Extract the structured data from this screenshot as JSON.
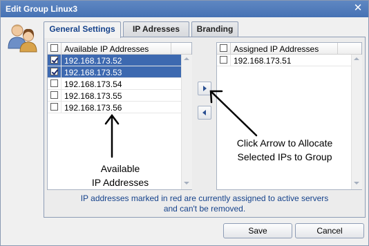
{
  "window": {
    "title": "Edit Group Linux3"
  },
  "icons": {
    "close": "close-icon",
    "group": "user-group-icon"
  },
  "tabs": [
    {
      "label": "General Settings",
      "active": true
    },
    {
      "label": "IP Adresses",
      "active": false
    },
    {
      "label": "Branding",
      "active": false
    }
  ],
  "available": {
    "header": "Available IP Addresses",
    "rows": [
      {
        "ip": "192.168.173.52",
        "checked": true,
        "selected": true
      },
      {
        "ip": "192.168.173.53",
        "checked": true,
        "selected": true
      },
      {
        "ip": "192.168.173.54",
        "checked": false,
        "selected": false
      },
      {
        "ip": "192.168.173.55",
        "checked": false,
        "selected": false
      },
      {
        "ip": "192.168.173.56",
        "checked": false,
        "selected": false
      }
    ]
  },
  "assigned": {
    "header": "Assigned IP Addresses",
    "rows": [
      {
        "ip": "192.168.173.51",
        "checked": false,
        "selected": false
      }
    ]
  },
  "annotations": {
    "available_line1": "Available",
    "available_line2": "IP Addresses",
    "allocate_line1": "Click Arrow to Allocate",
    "allocate_line2": "Selected IPs to Group"
  },
  "note": {
    "line1": "IP addresses marked in red are currently assigned to active servers",
    "line2": "and can't be removed."
  },
  "buttons": {
    "save": "Save",
    "cancel": "Cancel"
  },
  "colors": {
    "titlebar": "#4a76b8",
    "selected_row": "#3d69b0",
    "note_text": "#15428b"
  }
}
